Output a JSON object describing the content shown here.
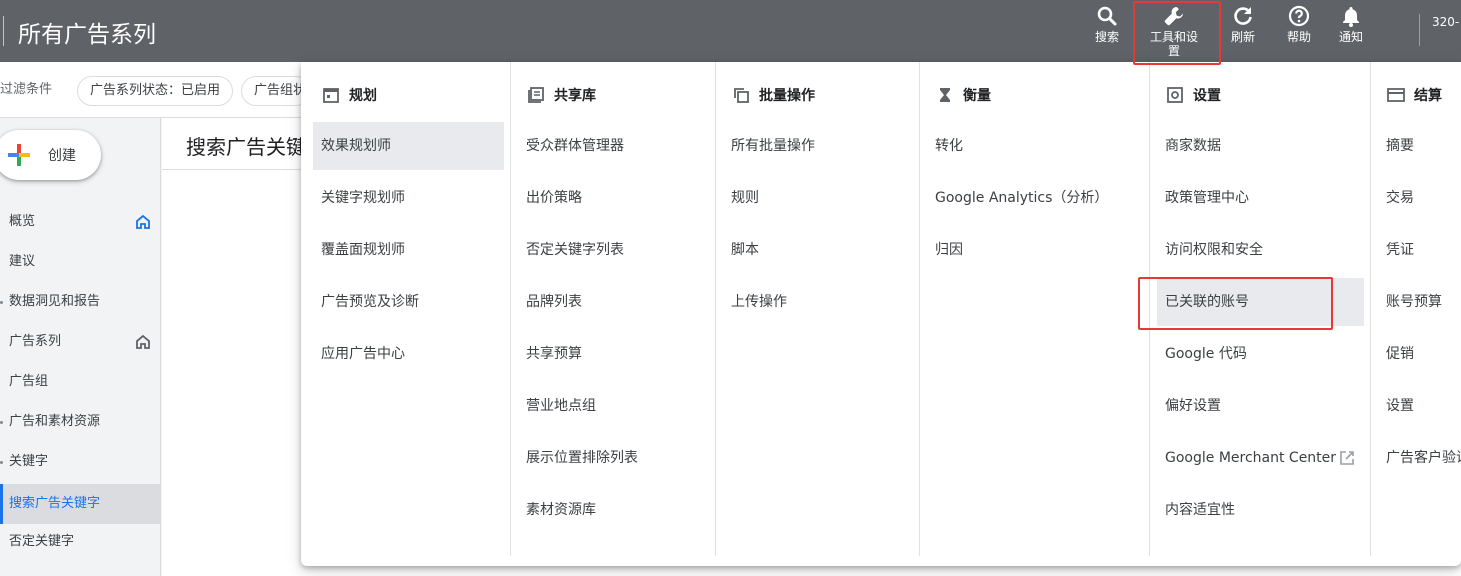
{
  "topbar": {
    "title": "所有广告系列",
    "search_label": "搜索",
    "tools_label": "工具和设置",
    "refresh_label": "刷新",
    "help_label": "帮助",
    "notify_label": "通知",
    "account_fragment": "320-"
  },
  "filters": {
    "label": "过滤条件",
    "chip1": "广告系列状态：已启用",
    "chip2": "广告组状"
  },
  "create_label": "创建",
  "main_title": "搜索广告关键",
  "sidenav": {
    "items": [
      {
        "label": "概览",
        "home": true
      },
      {
        "label": "建议"
      },
      {
        "label": "数据洞见和报告"
      },
      {
        "label": "广告系列",
        "home": true
      },
      {
        "label": "广告组"
      },
      {
        "label": "广告和素材资源"
      },
      {
        "label": "关键字"
      },
      {
        "label": "搜索广告关键字",
        "active": true
      },
      {
        "label": "否定关键字"
      }
    ]
  },
  "menu": {
    "planning": {
      "title": "规划",
      "items": [
        "效果规划师",
        "关键字规划师",
        "覆盖面规划师",
        "广告预览及诊断",
        "应用广告中心"
      ]
    },
    "shared": {
      "title": "共享库",
      "items": [
        "受众群体管理器",
        "出价策略",
        "否定关键字列表",
        "品牌列表",
        "共享预算",
        "营业地点组",
        "展示位置排除列表",
        "素材资源库"
      ]
    },
    "bulk": {
      "title": "批量操作",
      "items": [
        "所有批量操作",
        "规则",
        "脚本",
        "上传操作"
      ]
    },
    "measure": {
      "title": "衡量",
      "items": [
        "转化",
        "Google Analytics（分析）",
        "归因"
      ]
    },
    "settings": {
      "title": "设置",
      "items": [
        "商家数据",
        "政策管理中心",
        "访问权限和安全",
        "已关联的账号",
        "Google 代码",
        "偏好设置",
        "Google Merchant Center",
        "内容适宜性"
      ]
    },
    "billing": {
      "title": "结算",
      "items": [
        "摘要",
        "交易",
        "凭证",
        "账号预算",
        "促销",
        "设置",
        "广告客户验证"
      ]
    }
  },
  "colors": {
    "topbar": "#5f6368",
    "highlight": "#e53935",
    "accent": "#1a73e8"
  }
}
